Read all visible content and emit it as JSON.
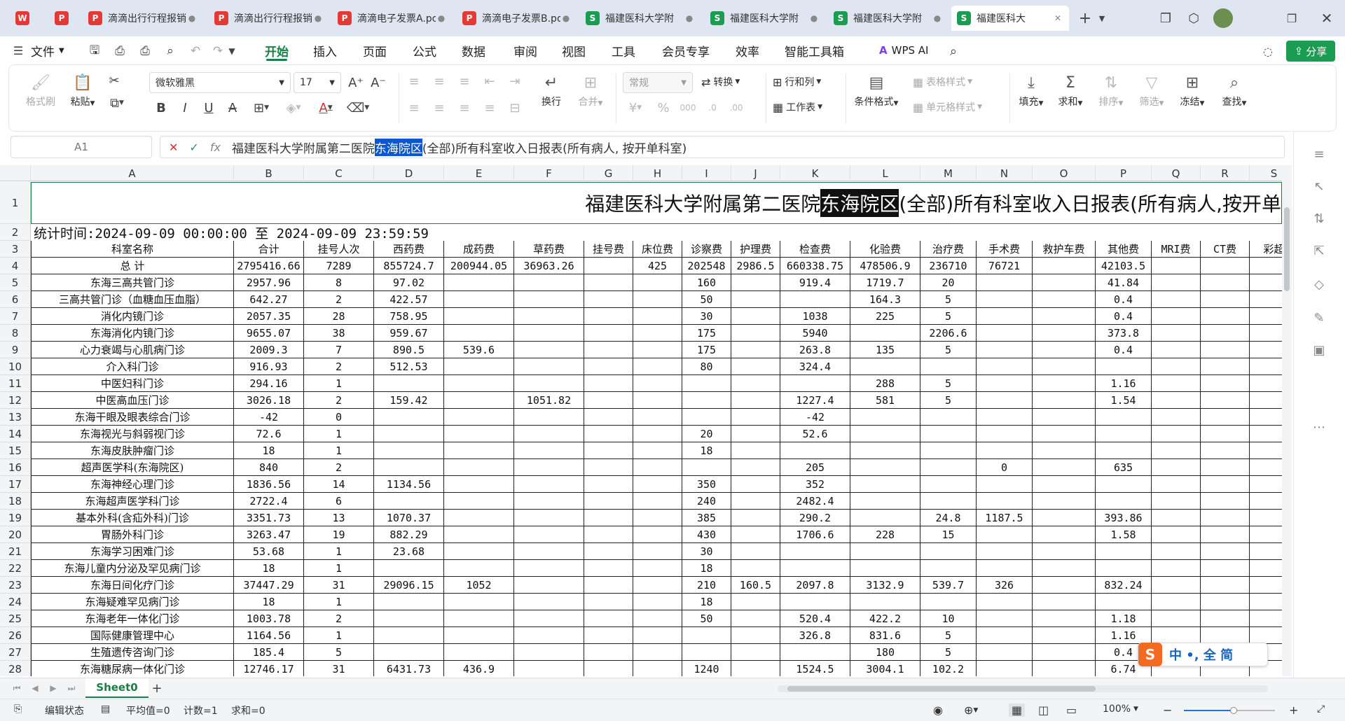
{
  "tabs": [
    {
      "label": "",
      "icon": "W",
      "color": "#e53935"
    },
    {
      "label": "",
      "icon": "P",
      "color": "#e53935"
    },
    {
      "label": "滴滴出行行程报销",
      "icon": "P",
      "color": "#e53935"
    },
    {
      "label": "滴滴出行行程报销",
      "icon": "P",
      "color": "#e53935"
    },
    {
      "label": "滴滴电子发票A.pc",
      "icon": "P",
      "color": "#e53935"
    },
    {
      "label": "滴滴电子发票B.pd",
      "icon": "P",
      "color": "#e53935"
    },
    {
      "label": "福建医科大学附",
      "icon": "S",
      "color": "#1a9c53"
    },
    {
      "label": "福建医科大学附",
      "icon": "S",
      "color": "#1a9c53"
    },
    {
      "label": "福建医科大学附",
      "icon": "S",
      "color": "#1a9c53"
    },
    {
      "label": "福建医科大",
      "icon": "S",
      "color": "#1a9c53"
    }
  ],
  "menu": {
    "file": "文件",
    "items": [
      "开始",
      "插入",
      "页面",
      "公式",
      "数据",
      "审阅",
      "视图",
      "工具",
      "会员专享",
      "效率",
      "智能工具箱"
    ],
    "wps_ai": "WPS AI",
    "share": "分享"
  },
  "ribbon": {
    "format_painter": "格式刷",
    "paste": "粘贴",
    "font_name": "微软雅黑",
    "font_size": "17",
    "wrap": "换行",
    "merge": "合并",
    "number_format": "常规",
    "convert": "转换",
    "row_col": "行和列",
    "worksheet": "工作表",
    "cond_format": "条件格式",
    "table_style": "表格样式",
    "cell_style": "单元格样式",
    "fill": "填充",
    "sum": "求和",
    "sort": "排序",
    "filter": "筛选",
    "freeze": "冻结",
    "find": "查找"
  },
  "formula": {
    "cell_ref": "A1",
    "prefix": "福建医科大学附属第二医院",
    "highlight": "东海院区",
    "suffix": "(全部)所有科室收入日报表(所有病人, 按开单科室)"
  },
  "sheet": {
    "columns": [
      "A",
      "B",
      "C",
      "D",
      "E",
      "F",
      "G",
      "H",
      "I",
      "J",
      "K",
      "L",
      "M",
      "N",
      "O",
      "P",
      "Q",
      "R",
      "S"
    ],
    "title_prefix": "福建医科大学附属第二医院",
    "title_highlight": "东海院区",
    "title_suffix": "(全部)所有科室收入日报表(所有病人,按开单",
    "time_label": "统计时间:2024-09-09 00:00:00    至            2024-09-09 23:59:59",
    "headers": [
      "科室名称",
      "合计",
      "挂号人次",
      "西药费",
      "成药费",
      "草药费",
      "挂号费",
      "床位费",
      "诊察费",
      "护理费",
      "检查费",
      "化验费",
      "治疗费",
      "手术费",
      "救护车费",
      "其他费",
      "MRI费",
      "CT费",
      "彩超"
    ],
    "rows": [
      [
        "总 计",
        "2795416.66",
        "7289",
        "855724.7",
        "200944.05",
        "36963.26",
        "",
        "425",
        "202548",
        "2986.5",
        "660338.75",
        "478506.9",
        "236710",
        "76721",
        "",
        "42103.5",
        "",
        "",
        ""
      ],
      [
        "东海三高共管门诊",
        "2957.96",
        "8",
        "97.02",
        "",
        "",
        "",
        "",
        "160",
        "",
        "919.4",
        "1719.7",
        "20",
        "",
        "",
        "41.84",
        "",
        "",
        ""
      ],
      [
        "三高共管门诊（血糖血压血脂）",
        "642.27",
        "2",
        "422.57",
        "",
        "",
        "",
        "",
        "50",
        "",
        "",
        "164.3",
        "5",
        "",
        "",
        "0.4",
        "",
        "",
        ""
      ],
      [
        "消化内镜门诊",
        "2057.35",
        "28",
        "758.95",
        "",
        "",
        "",
        "",
        "30",
        "",
        "1038",
        "225",
        "5",
        "",
        "",
        "0.4",
        "",
        "",
        ""
      ],
      [
        "东海消化内镜门诊",
        "9655.07",
        "38",
        "959.67",
        "",
        "",
        "",
        "",
        "175",
        "",
        "5940",
        "",
        "2206.6",
        "",
        "",
        "373.8",
        "",
        "",
        ""
      ],
      [
        "心力衰竭与心肌病门诊",
        "2009.3",
        "7",
        "890.5",
        "539.6",
        "",
        "",
        "",
        "175",
        "",
        "263.8",
        "135",
        "5",
        "",
        "",
        "0.4",
        "",
        "",
        ""
      ],
      [
        "介入科门诊",
        "916.93",
        "2",
        "512.53",
        "",
        "",
        "",
        "",
        "80",
        "",
        "324.4",
        "",
        "",
        "",
        "",
        "",
        "",
        "",
        ""
      ],
      [
        "中医妇科门诊",
        "294.16",
        "1",
        "",
        "",
        "",
        "",
        "",
        "",
        "",
        "",
        "288",
        "5",
        "",
        "",
        "1.16",
        "",
        "",
        ""
      ],
      [
        "中医高血压门诊",
        "3026.18",
        "2",
        "159.42",
        "",
        "1051.82",
        "",
        "",
        "",
        "",
        "1227.4",
        "581",
        "5",
        "",
        "",
        "1.54",
        "",
        "",
        ""
      ],
      [
        "东海干眼及眼表综合门诊",
        "-42",
        "0",
        "",
        "",
        "",
        "",
        "",
        "",
        "",
        "-42",
        "",
        "",
        "",
        "",
        "",
        "",
        "",
        ""
      ],
      [
        "东海视光与斜弱视门诊",
        "72.6",
        "1",
        "",
        "",
        "",
        "",
        "",
        "20",
        "",
        "52.6",
        "",
        "",
        "",
        "",
        "",
        "",
        "",
        ""
      ],
      [
        "东海皮肤肿瘤门诊",
        "18",
        "1",
        "",
        "",
        "",
        "",
        "",
        "18",
        "",
        "",
        "",
        "",
        "",
        "",
        "",
        "",
        "",
        ""
      ],
      [
        "超声医学科(东海院区)",
        "840",
        "2",
        "",
        "",
        "",
        "",
        "",
        "",
        "",
        "205",
        "",
        "",
        "0",
        "",
        "635",
        "",
        "",
        ""
      ],
      [
        "东海神经心理门诊",
        "1836.56",
        "14",
        "1134.56",
        "",
        "",
        "",
        "",
        "350",
        "",
        "352",
        "",
        "",
        "",
        "",
        "",
        "",
        "",
        ""
      ],
      [
        "东海超声医学科门诊",
        "2722.4",
        "6",
        "",
        "",
        "",
        "",
        "",
        "240",
        "",
        "2482.4",
        "",
        "",
        "",
        "",
        "",
        "",
        "",
        ""
      ],
      [
        "基本外科(含疝外科)门诊",
        "3351.73",
        "13",
        "1070.37",
        "",
        "",
        "",
        "",
        "385",
        "",
        "290.2",
        "",
        "24.8",
        "1187.5",
        "",
        "393.86",
        "",
        "",
        ""
      ],
      [
        "胃肠外科门诊",
        "3263.47",
        "19",
        "882.29",
        "",
        "",
        "",
        "",
        "430",
        "",
        "1706.6",
        "228",
        "15",
        "",
        "",
        "1.58",
        "",
        "",
        ""
      ],
      [
        "东海学习困难门诊",
        "53.68",
        "1",
        "23.68",
        "",
        "",
        "",
        "",
        "30",
        "",
        "",
        "",
        "",
        "",
        "",
        "",
        "",
        "",
        ""
      ],
      [
        "东海儿童内分泌及罕见病门诊",
        "18",
        "1",
        "",
        "",
        "",
        "",
        "",
        "18",
        "",
        "",
        "",
        "",
        "",
        "",
        "",
        "",
        "",
        ""
      ],
      [
        "东海日间化疗门诊",
        "37447.29",
        "31",
        "29096.15",
        "1052",
        "",
        "",
        "",
        "210",
        "160.5",
        "2097.8",
        "3132.9",
        "539.7",
        "326",
        "",
        "832.24",
        "",
        "",
        ""
      ],
      [
        "东海疑难罕见病门诊",
        "18",
        "1",
        "",
        "",
        "",
        "",
        "",
        "18",
        "",
        "",
        "",
        "",
        "",
        "",
        "",
        "",
        "",
        ""
      ],
      [
        "东海老年一体化门诊",
        "1003.78",
        "2",
        "",
        "",
        "",
        "",
        "",
        "50",
        "",
        "520.4",
        "422.2",
        "10",
        "",
        "",
        "1.18",
        "",
        "",
        ""
      ],
      [
        "国际健康管理中心",
        "1164.56",
        "1",
        "",
        "",
        "",
        "",
        "",
        "",
        "",
        "326.8",
        "831.6",
        "5",
        "",
        "",
        "1.16",
        "",
        "",
        ""
      ],
      [
        "生殖遗传咨询门诊",
        "185.4",
        "5",
        "",
        "",
        "",
        "",
        "",
        "",
        "",
        "",
        "180",
        "5",
        "",
        "",
        "0.4",
        "",
        "",
        ""
      ],
      [
        "东海糖尿病一体化门诊",
        "12746.17",
        "31",
        "6431.73",
        "436.9",
        "",
        "",
        "",
        "1240",
        "",
        "1524.5",
        "3004.1",
        "102.2",
        "",
        "",
        "6.74",
        "",
        "",
        ""
      ]
    ]
  },
  "sheet_tab": "Sheet0",
  "status": {
    "edit": "编辑状态",
    "avg": "平均值=0",
    "count": "计数=1",
    "sum": "求和=0",
    "zoom": "100%"
  },
  "ime": {
    "text": "中 •, 全 简"
  }
}
